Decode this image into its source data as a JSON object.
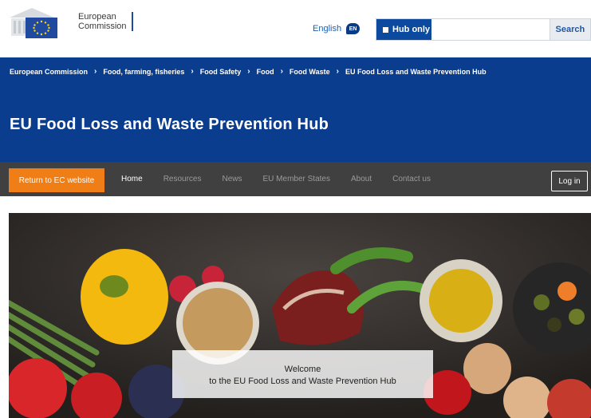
{
  "header": {
    "logo_line1": "European",
    "logo_line2": "Commission",
    "language": "English",
    "language_code": "EN",
    "hub_only_label": "Hub only",
    "search_value": "",
    "search_button": "Search"
  },
  "breadcrumb": [
    "European Commission",
    "Food, farming, fisheries",
    "Food Safety",
    "Food",
    "Food Waste",
    "EU Food Loss and Waste Prevention Hub"
  ],
  "site_title": "EU Food Loss and Waste Prevention Hub",
  "nav": {
    "return_label": "Return to EC website",
    "items": [
      "Home",
      "Resources",
      "News",
      "EU Member States",
      "About",
      "Contact us"
    ],
    "login_label": "Log in"
  },
  "hero": {
    "welcome_line1": "Welcome",
    "welcome_line2": "to the EU Food Loss and Waste Prevention Hub"
  },
  "colors": {
    "brand_blue": "#0b3d8e",
    "nav_dark": "#404040",
    "accent_orange": "#f07e17"
  },
  "icons": [
    "eu-flag-icon",
    "language-badge-icon",
    "checkbox-icon",
    "chevron-right-icon"
  ]
}
